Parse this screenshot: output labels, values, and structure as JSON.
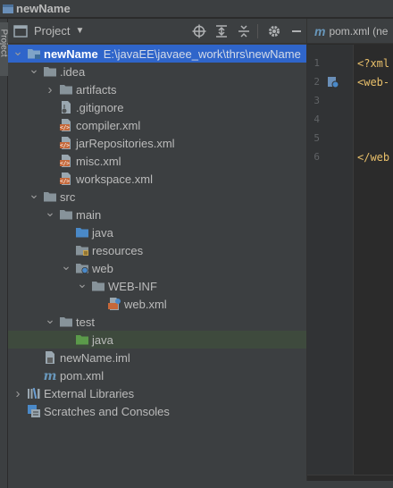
{
  "window": {
    "title": "newName"
  },
  "toolstrip": {
    "project_tab": "Project"
  },
  "panel": {
    "title": "Project",
    "dropdown_icon": "caret-down-icon",
    "tools": [
      "locate-icon",
      "expand-all-icon",
      "collapse-all-icon",
      "gear-icon",
      "minimize-icon"
    ]
  },
  "tree": [
    {
      "label": "newName",
      "path": "E:\\javaEE\\javaee_work\\thrs\\newName",
      "depth": 0,
      "arrow": "down",
      "icon": "module-folder",
      "bold": true,
      "state": "selected"
    },
    {
      "label": ".idea",
      "depth": 1,
      "arrow": "down",
      "icon": "folder"
    },
    {
      "label": "artifacts",
      "depth": 2,
      "arrow": "right",
      "icon": "folder"
    },
    {
      "label": ".gitignore",
      "depth": 2,
      "arrow": "",
      "icon": "gitignore-file"
    },
    {
      "label": "compiler.xml",
      "depth": 2,
      "arrow": "",
      "icon": "xml-file"
    },
    {
      "label": "jarRepositories.xml",
      "depth": 2,
      "arrow": "",
      "icon": "xml-file"
    },
    {
      "label": "misc.xml",
      "depth": 2,
      "arrow": "",
      "icon": "xml-file"
    },
    {
      "label": "workspace.xml",
      "depth": 2,
      "arrow": "",
      "icon": "xml-file"
    },
    {
      "label": "src",
      "depth": 1,
      "arrow": "down",
      "icon": "folder"
    },
    {
      "label": "main",
      "depth": 2,
      "arrow": "down",
      "icon": "folder"
    },
    {
      "label": "java",
      "depth": 3,
      "arrow": "",
      "icon": "source-folder"
    },
    {
      "label": "resources",
      "depth": 3,
      "arrow": "",
      "icon": "resources-folder"
    },
    {
      "label": "web",
      "depth": 3,
      "arrow": "down",
      "icon": "web-folder"
    },
    {
      "label": "WEB-INF",
      "depth": 4,
      "arrow": "down",
      "icon": "folder"
    },
    {
      "label": "web.xml",
      "depth": 5,
      "arrow": "",
      "icon": "web-xml-file"
    },
    {
      "label": "test",
      "depth": 2,
      "arrow": "down",
      "icon": "folder"
    },
    {
      "label": "java",
      "depth": 3,
      "arrow": "",
      "icon": "test-source-folder",
      "state": "highlight"
    },
    {
      "label": "newName.iml",
      "depth": 1,
      "arrow": "",
      "icon": "iml-file"
    },
    {
      "label": "pom.xml",
      "depth": 1,
      "arrow": "",
      "icon": "maven-file"
    },
    {
      "label": "External Libraries",
      "depth": 0,
      "arrow": "right",
      "icon": "libraries"
    },
    {
      "label": "Scratches and Consoles",
      "depth": 0,
      "arrow": "",
      "icon": "scratches"
    }
  ],
  "editor": {
    "tab_icon_letter": "m",
    "tab_name": "pom.xml (ne",
    "lines": [
      {
        "num": "1",
        "text": "<?xml",
        "marker": ""
      },
      {
        "num": "2",
        "text": "<web-",
        "marker": "web-marker-icon"
      },
      {
        "num": "3",
        "text": "",
        "marker": ""
      },
      {
        "num": "4",
        "text": "",
        "marker": ""
      },
      {
        "num": "5",
        "text": "",
        "marker": ""
      },
      {
        "num": "6",
        "text": "</web",
        "marker": ""
      }
    ]
  },
  "colors": {
    "selection": "#2f65ca",
    "highlight_row": "#3e4a3d",
    "folder": "#87939a",
    "source_folder": "#4a89c8",
    "test_folder": "#5b9a4a",
    "xml_orange": "#c5683a",
    "xml_tag": "#e8bf6a"
  }
}
